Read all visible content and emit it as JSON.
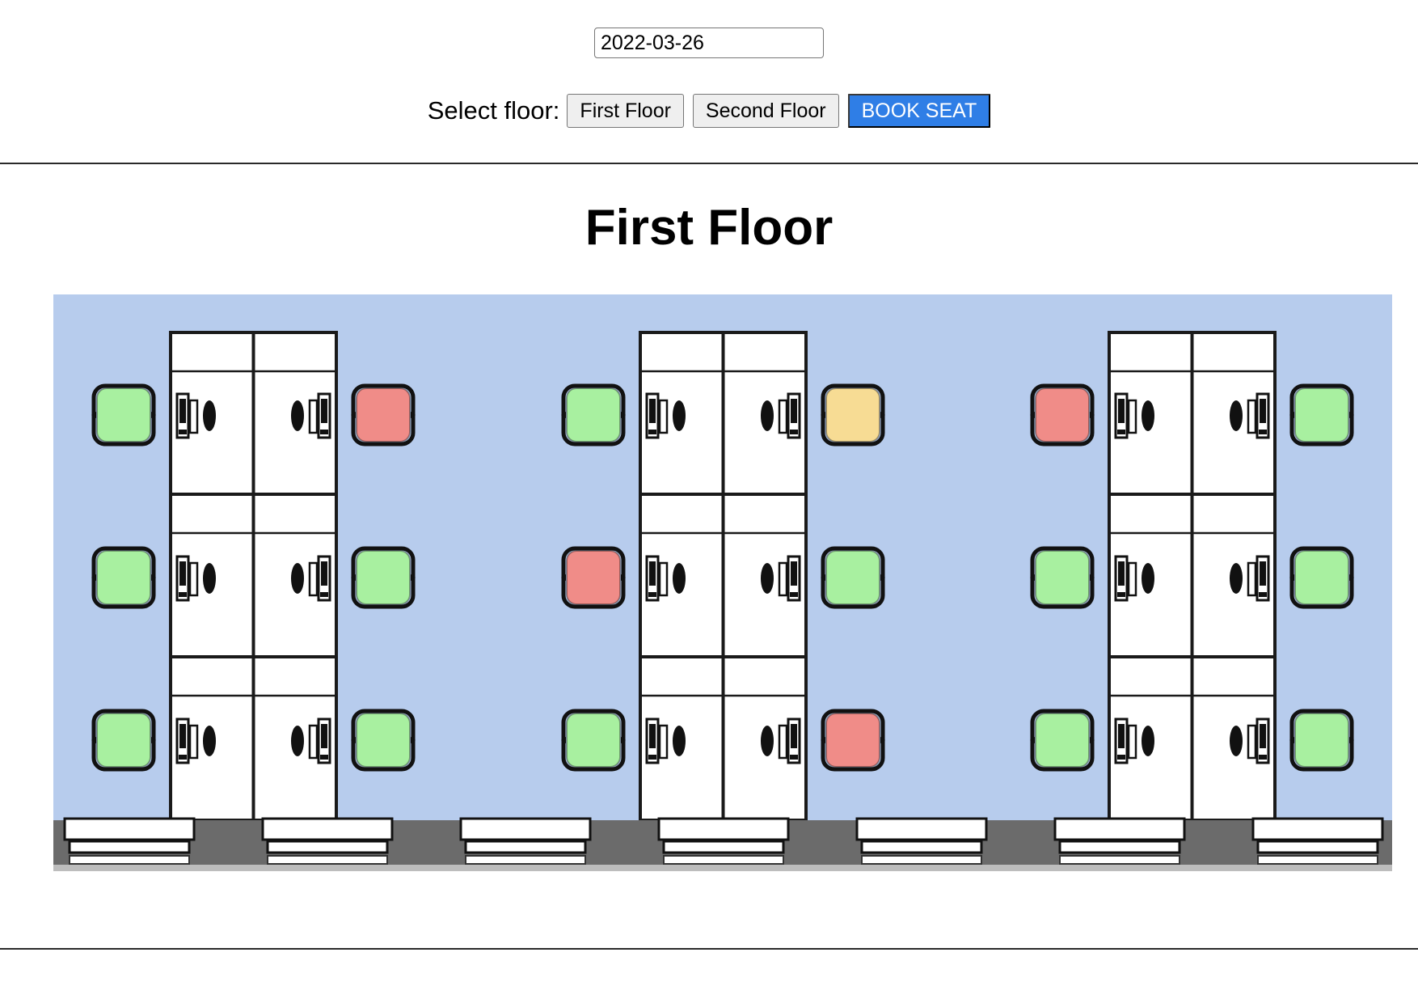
{
  "date_picker": {
    "value": "2022-03-26"
  },
  "floor_selector": {
    "label": "Select floor:",
    "buttons": [
      {
        "label": "First Floor"
      },
      {
        "label": "Second Floor"
      }
    ],
    "book_label": "BOOK SEAT"
  },
  "floor_title": "First Floor",
  "colors": {
    "available": "#a8f0a0",
    "booked": "#f08c88",
    "pending": "#f7dc94",
    "floor": "#b7cced",
    "accent": "#2f7ee6"
  },
  "seats": [
    {
      "status": "available"
    },
    {
      "status": "booked"
    },
    {
      "status": "available"
    },
    {
      "status": "available"
    },
    {
      "status": "available"
    },
    {
      "status": "available"
    },
    {
      "status": "available"
    },
    {
      "status": "pending"
    },
    {
      "status": "booked"
    },
    {
      "status": "available"
    },
    {
      "status": "available"
    },
    {
      "status": "booked"
    },
    {
      "status": "booked"
    },
    {
      "status": "available"
    },
    {
      "status": "available"
    },
    {
      "status": "available"
    },
    {
      "status": "available"
    },
    {
      "status": "available"
    }
  ]
}
